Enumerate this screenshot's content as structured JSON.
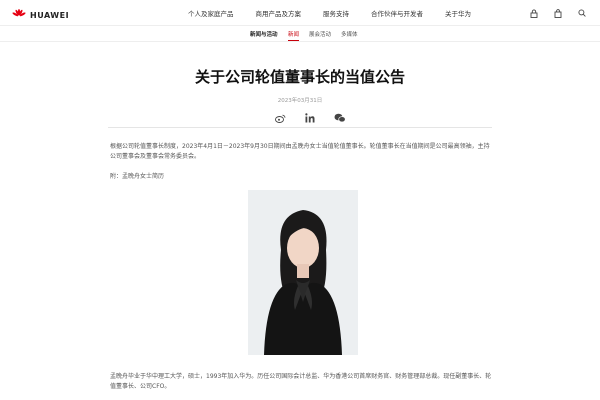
{
  "brand": {
    "name": "HUAWEI"
  },
  "topnav": {
    "items": [
      {
        "label": "个人及家庭产品"
      },
      {
        "label": "商用产品及方案"
      },
      {
        "label": "服务支持"
      },
      {
        "label": "合作伙伴与开发者"
      },
      {
        "label": "关于华为"
      }
    ],
    "icons": [
      "lock-icon",
      "bag-icon",
      "search-icon"
    ]
  },
  "subnav": {
    "title": "新闻与活动",
    "links": [
      {
        "label": "新闻",
        "active": true
      },
      {
        "label": "展会活动",
        "active": false
      },
      {
        "label": "多媒体",
        "active": false
      }
    ]
  },
  "article": {
    "title": "关于公司轮值董事长的当值公告",
    "date": "2023年03月31日",
    "share_icons": [
      "weibo-icon",
      "linkedin-icon",
      "wechat-icon"
    ],
    "paragraph1": "根据公司轮值董事长制度，2023年4月1日－2023年9月30日期间由孟晚舟女士当值轮值董事长。轮值董事长在当值期间是公司最高领袖，主持公司董事会及董事会常务委员会。",
    "paragraph2": "附：孟晚舟女士简历",
    "paragraph3": "孟晚舟毕业于华中理工大学，硕士，1993年加入华为。历任公司国际会计总监、华为香港公司首席财务官、财务管理部总裁。现任副董事长、轮值董事长、公司CFO。"
  },
  "colors": {
    "accent": "#c7000b",
    "brand_red": "#e60012"
  }
}
